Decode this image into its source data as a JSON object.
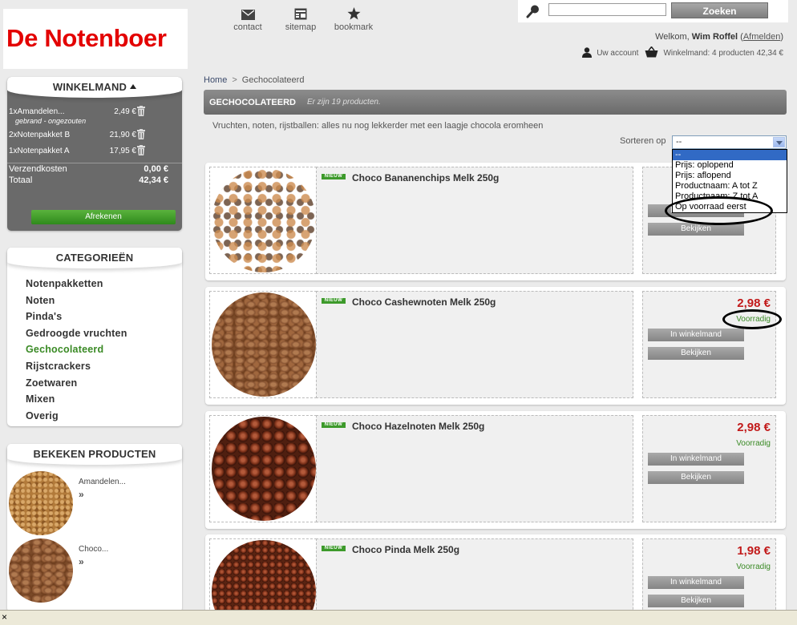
{
  "brand": {
    "logo_text": "De Notenboer",
    "accent": "#e30000",
    "green": "#3a8a25",
    "price_red": "#c21a1a"
  },
  "topnav": [
    {
      "label": "contact",
      "icon": "envelope-icon"
    },
    {
      "label": "sitemap",
      "icon": "sitemap-icon"
    },
    {
      "label": "bookmark",
      "icon": "star-icon"
    }
  ],
  "search": {
    "value": "",
    "button": "Zoeken"
  },
  "user": {
    "welcome": "Welkom,",
    "name": "Wim Roffel",
    "logout": "Afmelden",
    "account": "Uw account",
    "cart_summary": "Winkelmand: 4 producten 42,34 €"
  },
  "cart": {
    "title": "WINKELMAND",
    "items": [
      {
        "name": "1xAmandelen...",
        "price": "2,49 €",
        "note": "gebrand - ongezouten"
      },
      {
        "name": "2xNotenpakket B",
        "price": "21,90 €"
      },
      {
        "name": "1xNotenpakket A",
        "price": "17,95 €"
      }
    ],
    "shipping_label": "Verzendkosten",
    "shipping_value": "0,00 €",
    "total_label": "Totaal",
    "total_value": "42,34 €",
    "checkout": "Afrekenen"
  },
  "categories": {
    "title": "CATEGORIEËN",
    "items": [
      "Notenpakketten",
      "Noten",
      "Pinda's",
      "Gedroogde vruchten",
      "Gechocolateerd",
      "Rijstcrackers",
      "Zoetwaren",
      "Mixen",
      "Overig"
    ],
    "active": "Gechocolateerd"
  },
  "viewed": {
    "title": "BEKEKEN PRODUCTEN",
    "items": [
      {
        "name": "Amandelen...",
        "arrow": "»"
      },
      {
        "name": "Choco...",
        "arrow": "»"
      }
    ]
  },
  "breadcrumb": {
    "home": "Home",
    "sep": ">",
    "current": "Gechocolateerd"
  },
  "category_header": {
    "title": "GECHOCOLATEERD",
    "count": "Er zijn 19 producten."
  },
  "category_description": "Vruchten, noten, rijstballen: alles nu nog lekkerder met een laagje chocola eromheen",
  "sort": {
    "label": "Sorteren op",
    "value": "--",
    "options": [
      "--",
      "Prijs: oplopend",
      "Prijs: aflopend",
      "Productnaam: A tot Z",
      "Productnaam: Z tot A",
      "Op voorraad eerst"
    ],
    "highlighted": 0
  },
  "products": [
    {
      "badge": "NIEUW",
      "name": "Choco Bananenchips Melk 250g",
      "price": "",
      "stock": "",
      "add": "In winkelmand",
      "view": "Bekijken"
    },
    {
      "badge": "NIEUW",
      "name": "Choco Cashewnoten Melk 250g",
      "price": "2,98 €",
      "stock": "Voorradig",
      "add": "In winkelmand",
      "view": "Bekijken"
    },
    {
      "badge": "NIEUW",
      "name": "Choco Hazelnoten Melk 250g",
      "price": "2,98 €",
      "stock": "Voorradig",
      "add": "In winkelmand",
      "view": "Bekijken"
    },
    {
      "badge": "NIEUW",
      "name": "Choco Pinda Melk 250g",
      "price": "1,98 €",
      "stock": "Voorradig",
      "add": "In winkelmand",
      "view": "Bekijken"
    }
  ],
  "statusbar": {
    "close": "×"
  }
}
